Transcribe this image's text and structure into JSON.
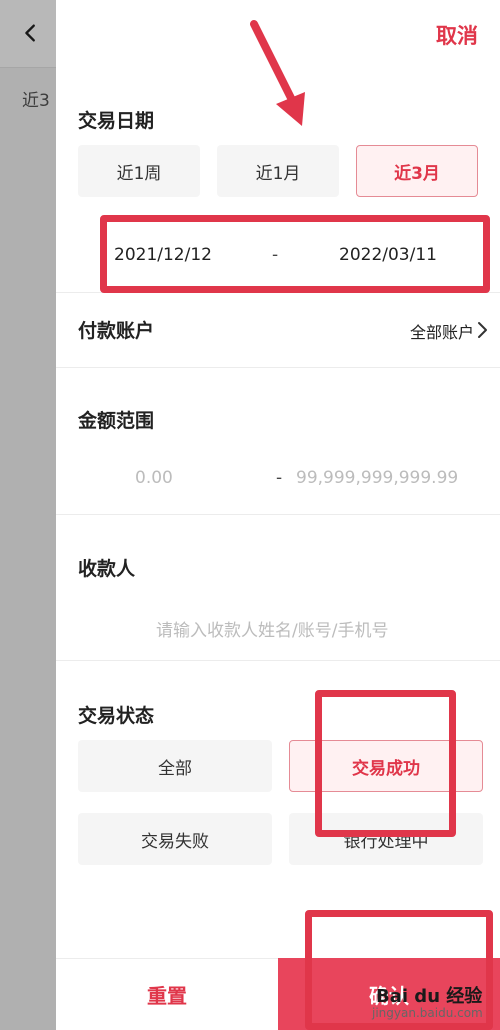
{
  "background": {
    "range_text": "近3"
  },
  "panel": {
    "cancel_label": "取消",
    "date": {
      "title": "交易日期",
      "options": [
        "近1周",
        "近1月",
        "近3月"
      ],
      "selected": "近3月",
      "start": "2021/12/12",
      "separator": "-",
      "end": "2022/03/11"
    },
    "account": {
      "label": "付款账户",
      "value": "全部账户"
    },
    "amount": {
      "title": "金额范围",
      "min_placeholder": "0.00",
      "separator": "-",
      "max_placeholder": "99,999,999,999.99"
    },
    "payee": {
      "title": "收款人",
      "placeholder": "请输入收款人姓名/账号/手机号"
    },
    "status": {
      "title": "交易状态",
      "options": [
        "全部",
        "交易成功",
        "交易失败",
        "银行处理中"
      ],
      "selected": "交易成功"
    },
    "footer": {
      "reset_label": "重置",
      "confirm_label": "确认"
    }
  },
  "watermark": {
    "logo_text": "Bai du 经验",
    "url": "jingyan.baidu.com"
  },
  "colors": {
    "accent": "#e0364a",
    "confirm_bg": "#e8455c",
    "chip_bg": "#f5f5f5",
    "annotation": "#e0364a"
  },
  "icons": {
    "back": "chevron-left-icon",
    "account_arrow": "chevron-right-icon"
  }
}
